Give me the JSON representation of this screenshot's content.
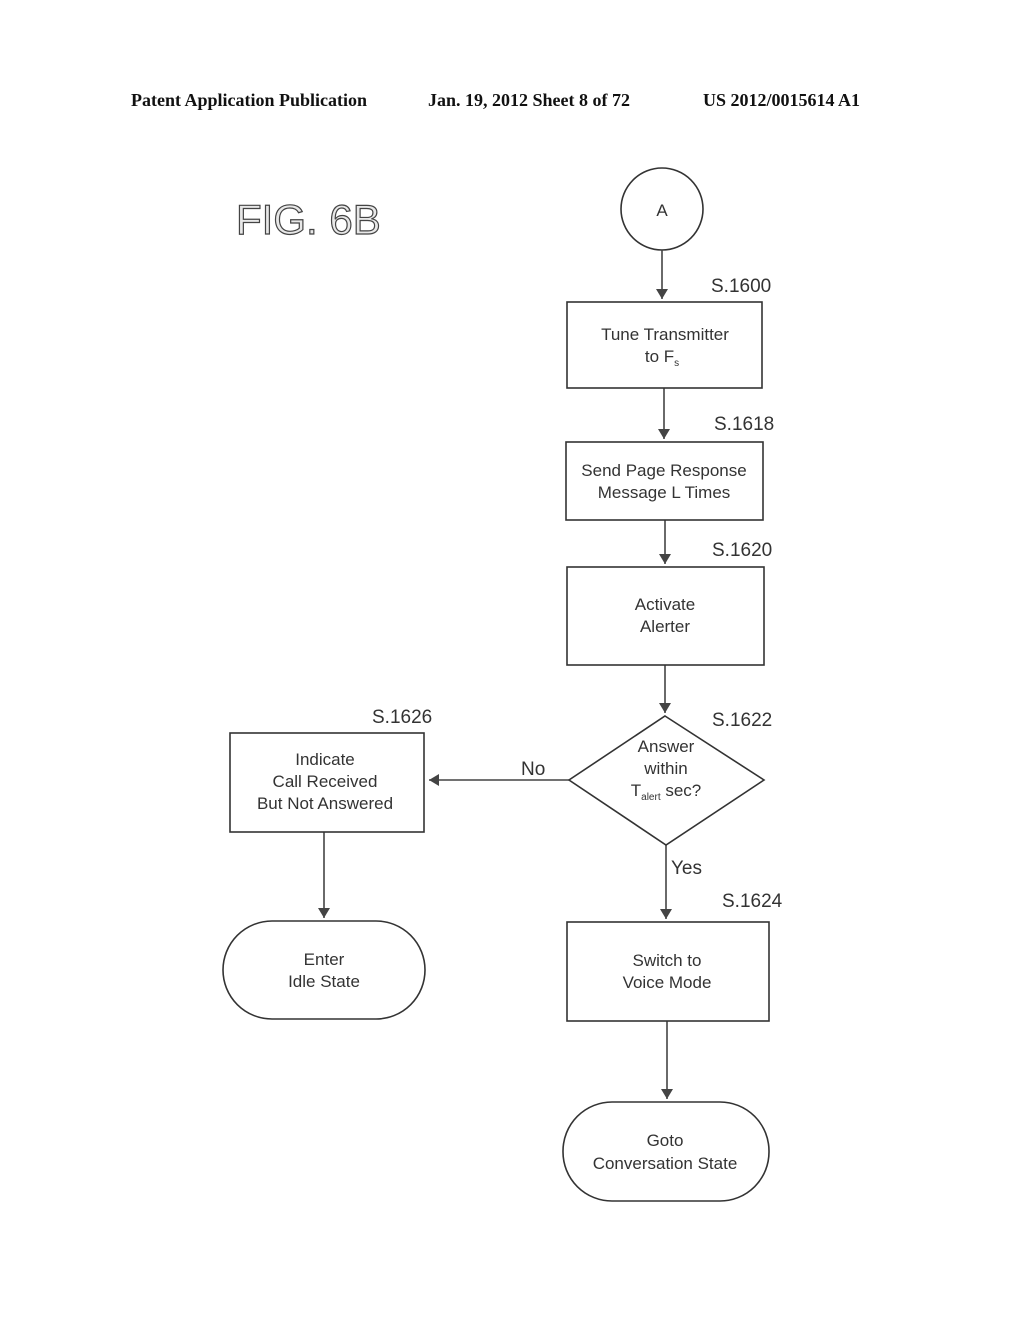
{
  "header": {
    "publication": "Patent Application Publication",
    "date_sheet": "Jan. 19, 2012  Sheet 8 of 72",
    "patent_number": "US 2012/0015614 A1"
  },
  "figure": {
    "label": "FIG. 6B",
    "connector": "A",
    "nodes": {
      "s1600": {
        "step": "S.1600",
        "line1": "Tune Transmitter",
        "line2_main": "to F",
        "line2_sub": "s"
      },
      "s1618": {
        "step": "S.1618",
        "line1": "Send Page Response",
        "line2": "Message L Times"
      },
      "s1620": {
        "step": "S.1620",
        "line1": "Activate",
        "line2": "Alerter"
      },
      "s1622": {
        "step": "S.1622",
        "line1": "Answer",
        "line2": "within",
        "line3_main": "T",
        "line3_sub": "alert",
        "line3_tail": " sec?"
      },
      "s1626": {
        "step": "S.1626",
        "line1": "Indicate",
        "line2": "Call Received",
        "line3": "But Not Answered"
      },
      "idle": {
        "line1": "Enter",
        "line2": "Idle State"
      },
      "s1624": {
        "step": "S.1624",
        "line1": "Switch to",
        "line2": "Voice Mode"
      },
      "conversation": {
        "line1": "Goto",
        "line2": "Conversation State"
      }
    },
    "edges": {
      "no_label": "No",
      "yes_label": "Yes"
    }
  }
}
